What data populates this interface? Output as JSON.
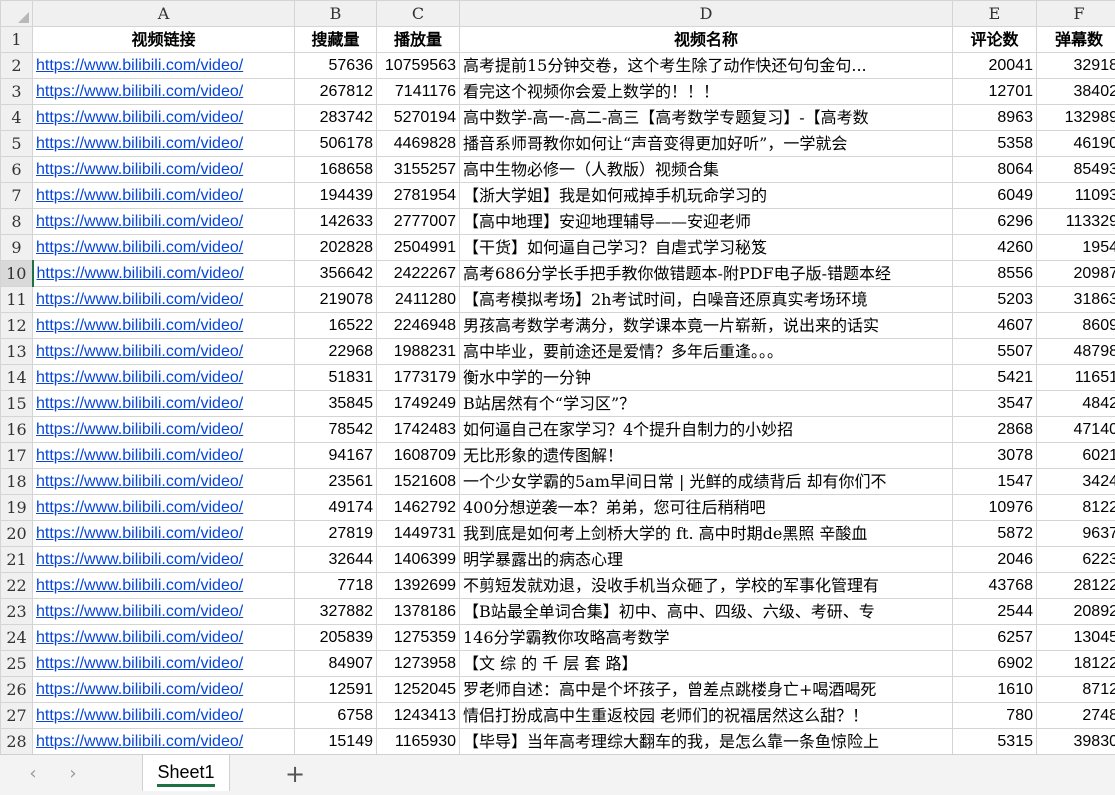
{
  "columns": [
    "A",
    "B",
    "C",
    "D",
    "E",
    "F"
  ],
  "header_row": {
    "row": "1",
    "cells": [
      "视频链接",
      "搜藏量",
      "播放量",
      "视频名称",
      "评论数",
      "弹幕数"
    ]
  },
  "rows": [
    {
      "row": "2",
      "link": "https://www.bilibili.com/video/",
      "fav": "57636",
      "play": "10759563",
      "title": "高考提前15分钟交卷，这个考生除了动作快还句句金句...",
      "comments": "20041",
      "danmaku": "32918"
    },
    {
      "row": "3",
      "link": "https://www.bilibili.com/video/",
      "fav": "267812",
      "play": "7141176",
      "title": "看完这个视频你会爱上数学的！！！",
      "comments": "12701",
      "danmaku": "38402"
    },
    {
      "row": "4",
      "link": "https://www.bilibili.com/video/",
      "fav": "283742",
      "play": "5270194",
      "title": "高中数学-高一-高二-高三【高考数学专题复习】-【高考数",
      "comments": "8963",
      "danmaku": "132989"
    },
    {
      "row": "5",
      "link": "https://www.bilibili.com/video/",
      "fav": "506178",
      "play": "4469828",
      "title": "播音系师哥教你如何让“声音变得更加好听”，一学就会",
      "comments": "5358",
      "danmaku": "46190"
    },
    {
      "row": "6",
      "link": "https://www.bilibili.com/video/",
      "fav": "168658",
      "play": "3155257",
      "title": "高中生物必修一（人教版）视频合集",
      "comments": "8064",
      "danmaku": "85493"
    },
    {
      "row": "7",
      "link": "https://www.bilibili.com/video/",
      "fav": "194439",
      "play": "2781954",
      "title": "【浙大学姐】我是如何戒掉手机玩命学习的",
      "comments": "6049",
      "danmaku": "11093"
    },
    {
      "row": "8",
      "link": "https://www.bilibili.com/video/",
      "fav": "142633",
      "play": "2777007",
      "title": "【高中地理】安迎地理辅导——安迎老师",
      "comments": "6296",
      "danmaku": "113329"
    },
    {
      "row": "9",
      "link": "https://www.bilibili.com/video/",
      "fav": "202828",
      "play": "2504991",
      "title": "【干货】如何逼自己学习？自虐式学习秘笈",
      "comments": "4260",
      "danmaku": "1954"
    },
    {
      "row": "10",
      "link": "https://www.bilibili.com/video/",
      "fav": "356642",
      "play": "2422267",
      "title": "高考686分学长手把手教你做错题本-附PDF电子版-错题本经",
      "comments": "8556",
      "danmaku": "20987"
    },
    {
      "row": "11",
      "link": "https://www.bilibili.com/video/",
      "fav": "219078",
      "play": "2411280",
      "title": "【高考模拟考场】2h考试时间，白噪音还原真实考场环境",
      "comments": "5203",
      "danmaku": "31863"
    },
    {
      "row": "12",
      "link": "https://www.bilibili.com/video/",
      "fav": "16522",
      "play": "2246948",
      "title": "男孩高考数学考满分，数学课本竟一片崭新，说出来的话实",
      "comments": "4607",
      "danmaku": "8609"
    },
    {
      "row": "13",
      "link": "https://www.bilibili.com/video/",
      "fav": "22968",
      "play": "1988231",
      "title": "高中毕业，要前途还是爱情？多年后重逢。。。",
      "comments": "5507",
      "danmaku": "48798"
    },
    {
      "row": "14",
      "link": "https://www.bilibili.com/video/",
      "fav": "51831",
      "play": "1773179",
      "title": "衡水中学的一分钟",
      "comments": "5421",
      "danmaku": "11651"
    },
    {
      "row": "15",
      "link": "https://www.bilibili.com/video/",
      "fav": "35845",
      "play": "1749249",
      "title": "B站居然有个“学习区”？",
      "comments": "3547",
      "danmaku": "4842"
    },
    {
      "row": "16",
      "link": "https://www.bilibili.com/video/",
      "fav": "78542",
      "play": "1742483",
      "title": "如何逼自己在家学习？4个提升自制力的小妙招",
      "comments": "2868",
      "danmaku": "47140"
    },
    {
      "row": "17",
      "link": "https://www.bilibili.com/video/",
      "fav": "94167",
      "play": "1608709",
      "title": "无比形象的遗传图解！",
      "comments": "3078",
      "danmaku": "6021"
    },
    {
      "row": "18",
      "link": "https://www.bilibili.com/video/",
      "fav": "23561",
      "play": "1521608",
      "title": "一个少女学霸的5am早间日常 | 光鲜的成绩背后 却有你们不",
      "comments": "1547",
      "danmaku": "3424"
    },
    {
      "row": "19",
      "link": "https://www.bilibili.com/video/",
      "fav": "49174",
      "play": "1462792",
      "title": "400分想逆袭一本？弟弟，您可往后稍稍吧",
      "comments": "10976",
      "danmaku": "8122"
    },
    {
      "row": "20",
      "link": "https://www.bilibili.com/video/",
      "fav": "27819",
      "play": "1449731",
      "title": "我到底是如何考上剑桥大学的 ft. 高中时期de黑照 辛酸血",
      "comments": "5872",
      "danmaku": "9637"
    },
    {
      "row": "21",
      "link": "https://www.bilibili.com/video/",
      "fav": "32644",
      "play": "1406399",
      "title": "明学暴露出的病态心理",
      "comments": "2046",
      "danmaku": "6223"
    },
    {
      "row": "22",
      "link": "https://www.bilibili.com/video/",
      "fav": "7718",
      "play": "1392699",
      "title": "不剪短发就劝退，没收手机当众砸了，学校的军事化管理有",
      "comments": "43768",
      "danmaku": "28122"
    },
    {
      "row": "23",
      "link": "https://www.bilibili.com/video/",
      "fav": "327882",
      "play": "1378186",
      "title": "【B站最全单词合集】初中、高中、四级、六级、考研、专",
      "comments": "2544",
      "danmaku": "20892"
    },
    {
      "row": "24",
      "link": "https://www.bilibili.com/video/",
      "fav": "205839",
      "play": "1275359",
      "title": "146分学霸教你攻略高考数学",
      "comments": "6257",
      "danmaku": "13045"
    },
    {
      "row": "25",
      "link": "https://www.bilibili.com/video/",
      "fav": "84907",
      "play": "1273958",
      "title": "【文 综 的 千 层 套 路】",
      "comments": "6902",
      "danmaku": "18122"
    },
    {
      "row": "26",
      "link": "https://www.bilibili.com/video/",
      "fav": "12591",
      "play": "1252045",
      "title": "罗老师自述：高中是个坏孩子，曾差点跳楼身亡+喝酒喝死",
      "comments": "1610",
      "danmaku": "8712"
    },
    {
      "row": "27",
      "link": "https://www.bilibili.com/video/",
      "fav": "6758",
      "play": "1243413",
      "title": "情侣打扮成高中生重返校园 老师们的祝福居然这么甜？！",
      "comments": "780",
      "danmaku": "2748"
    },
    {
      "row": "28",
      "link": "https://www.bilibili.com/video/",
      "fav": "15149",
      "play": "1165930",
      "title": "【毕导】当年高考理综大翻车的我，是怎么靠一条鱼惊险上",
      "comments": "5315",
      "danmaku": "39830"
    }
  ],
  "tabs": {
    "prev_icon": "chevron-left-icon",
    "next_icon": "chevron-right-icon",
    "sheet_name": "Sheet1",
    "add_icon": "plus-icon"
  },
  "colors": {
    "link": "#0645d8",
    "grid": "#d4d4d4",
    "header_bg": "#f0f0f0",
    "accent": "#1e7145"
  }
}
